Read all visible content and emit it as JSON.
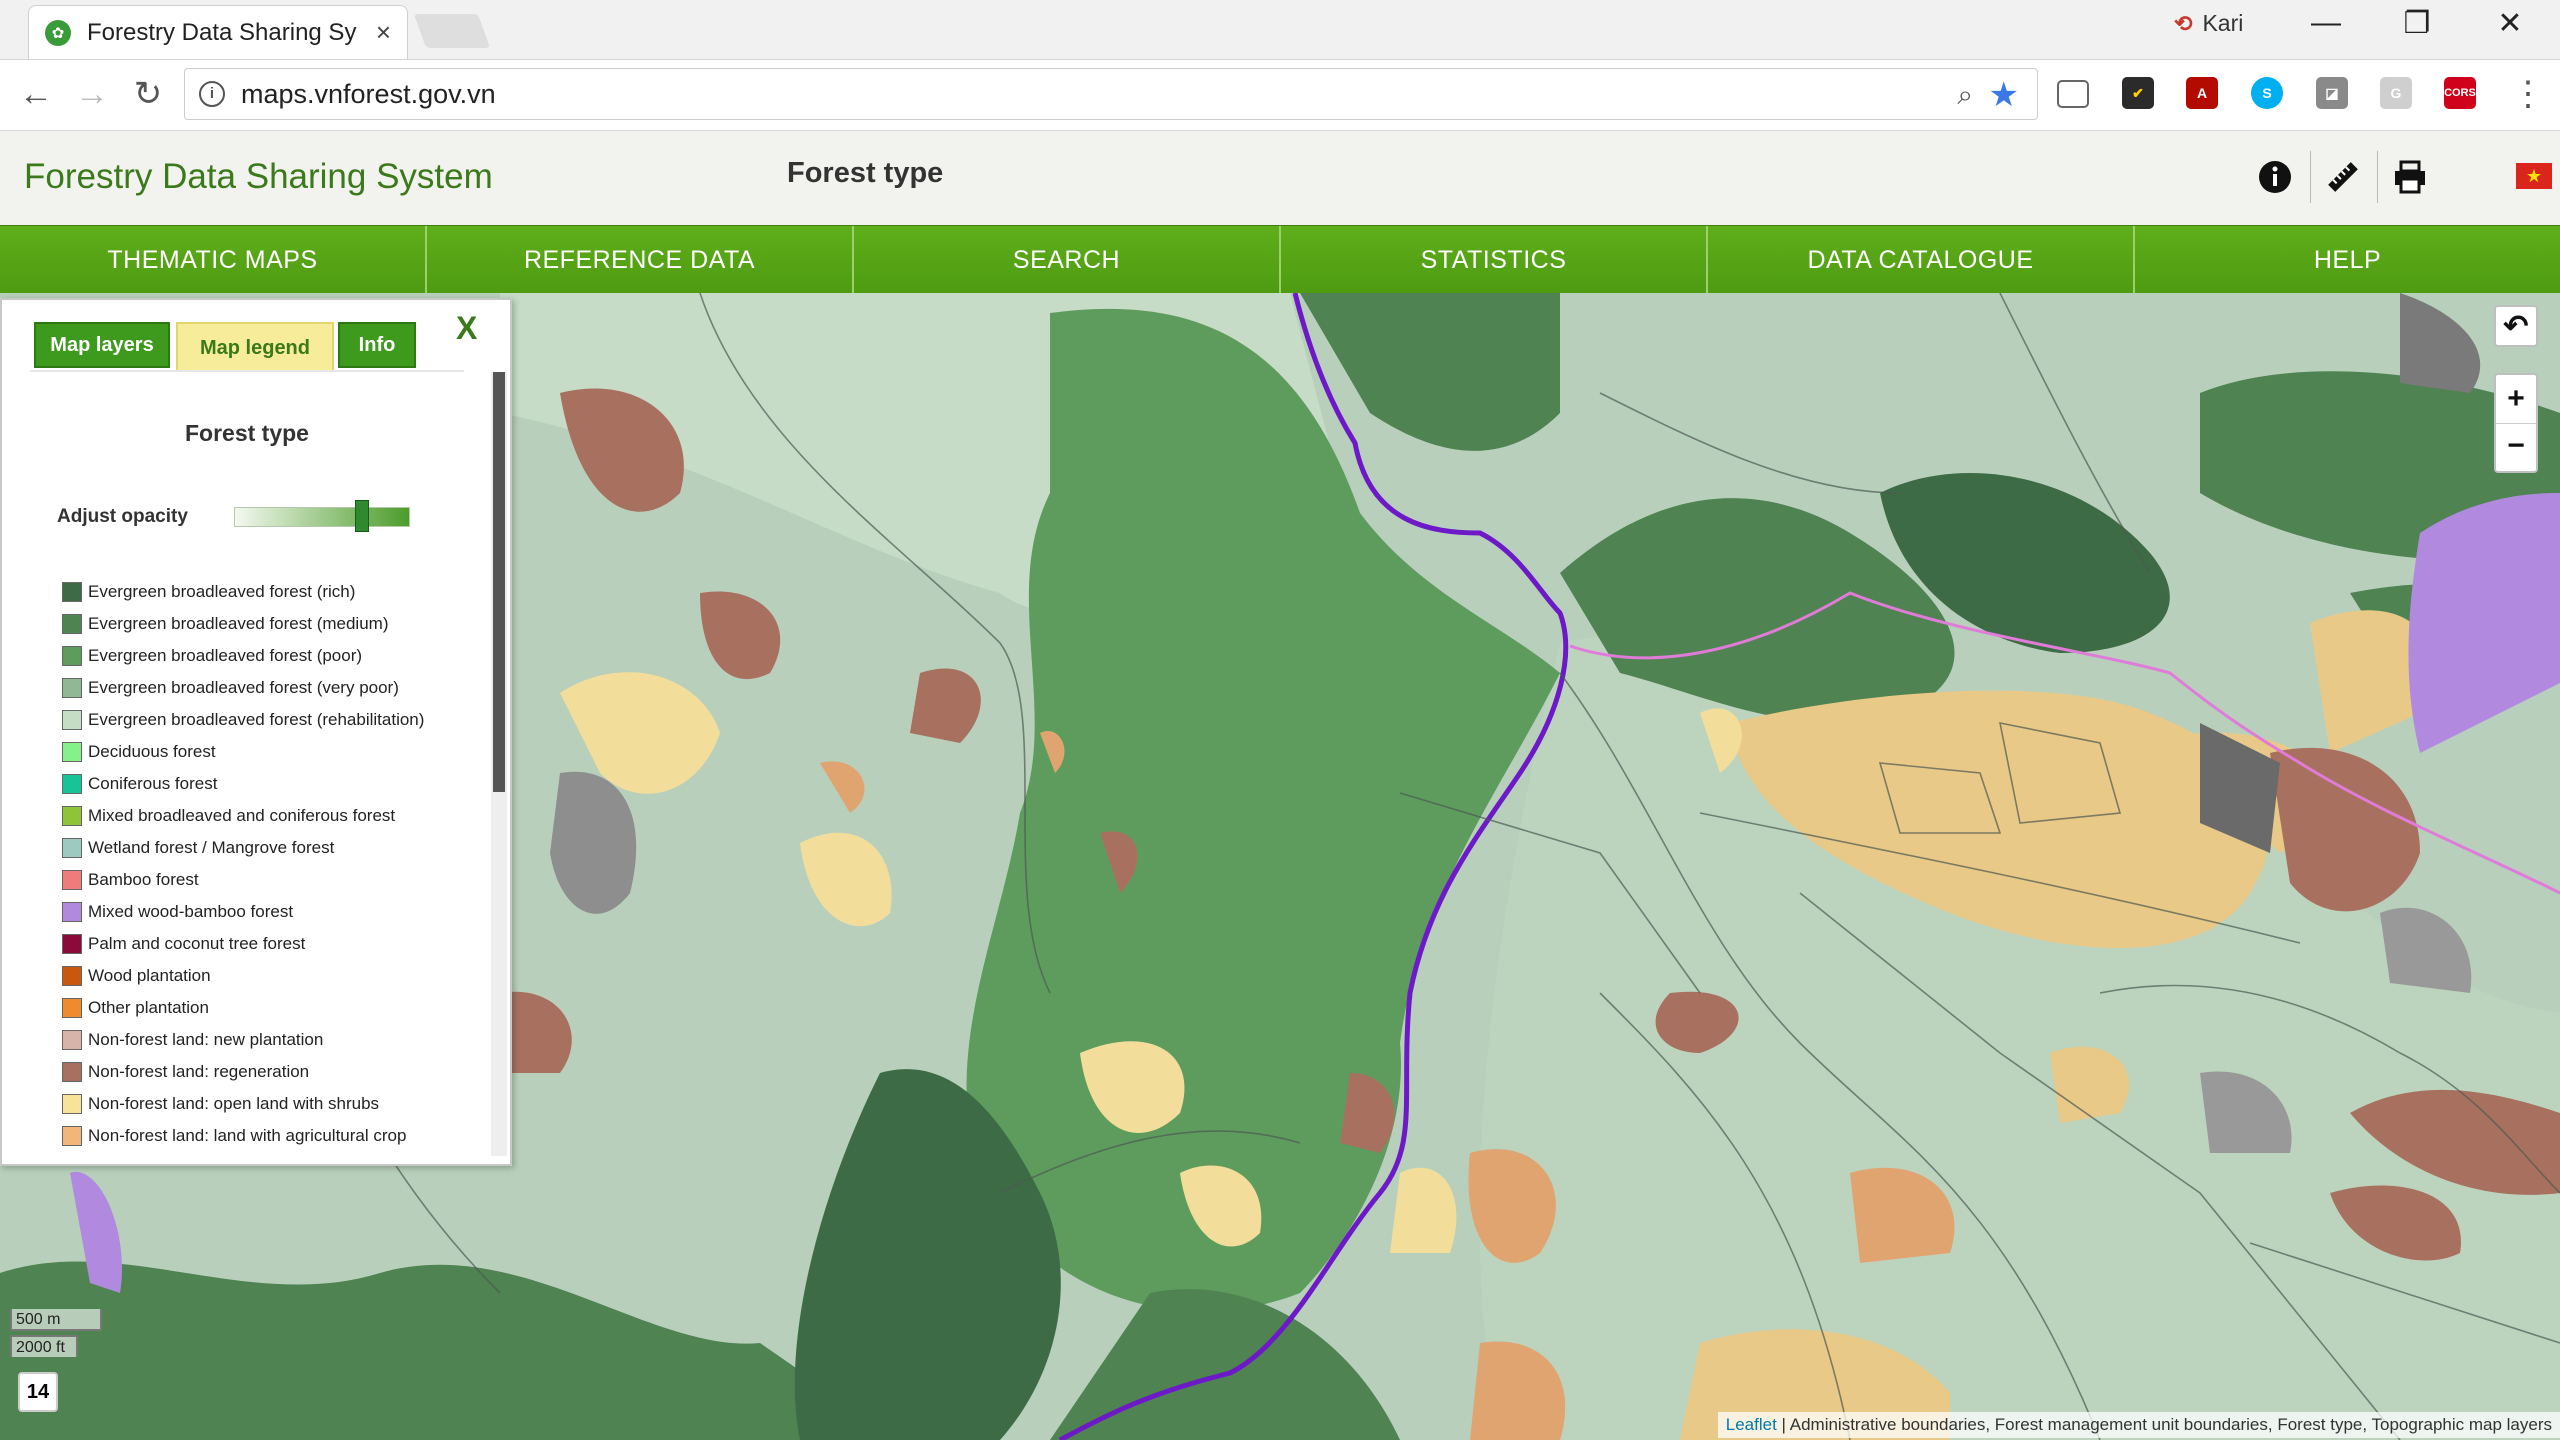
{
  "browser": {
    "tab_title": "Forestry Data Sharing Sy",
    "tab_close": "×",
    "user_name": "Kari",
    "url": "maps.vnforest.gov.vn",
    "extensions": [
      "cast-icon",
      "norton-icon",
      "acrobat-icon",
      "skype-icon",
      "extension-icon",
      "g-icon",
      "cors-icon"
    ],
    "cors_label": "CORS",
    "g_label": "G",
    "minimize": "—",
    "restore": "❐",
    "close": "✕"
  },
  "header": {
    "app_title": "Forestry Data Sharing System",
    "page_title": "Forest type"
  },
  "nav": {
    "items": [
      "THEMATIC MAPS",
      "REFERENCE DATA",
      "SEARCH",
      "STATISTICS",
      "DATA CATALOGUE",
      "HELP"
    ]
  },
  "panel": {
    "tabs": [
      "Map layers",
      "Map legend",
      "Info"
    ],
    "active_tab": "Map legend",
    "close": "X",
    "legend_title": "Forest type",
    "opacity_label": "Adjust opacity",
    "opacity_value": 0.73,
    "legend_items": [
      {
        "label": "Evergreen broadleaved forest (rich)",
        "color": "#3d6b45"
      },
      {
        "label": "Evergreen broadleaved forest (medium)",
        "color": "#4f8352"
      },
      {
        "label": "Evergreen broadleaved forest (poor)",
        "color": "#5e9c5e"
      },
      {
        "label": "Evergreen broadleaved forest (very poor)",
        "color": "#8fb893"
      },
      {
        "label": "Evergreen broadleaved forest (rehabilitation)",
        "color": "#c5dcc5"
      },
      {
        "label": "Deciduous forest",
        "color": "#86f08a"
      },
      {
        "label": "Coniferous forest",
        "color": "#17c497"
      },
      {
        "label": "Mixed broadleaved and coniferous forest",
        "color": "#8fc43a"
      },
      {
        "label": "Wetland forest / Mangrove forest",
        "color": "#9ec9c0"
      },
      {
        "label": "Bamboo forest",
        "color": "#f07b7b"
      },
      {
        "label": "Mixed wood-bamboo forest",
        "color": "#b18ae0"
      },
      {
        "label": "Palm and coconut tree forest",
        "color": "#8a0a3a"
      },
      {
        "label": "Wood plantation",
        "color": "#c9580e"
      },
      {
        "label": "Other plantation",
        "color": "#f08a2e"
      },
      {
        "label": "Non-forest land: new plantation",
        "color": "#d8b4a8"
      },
      {
        "label": "Non-forest land: regeneration",
        "color": "#a8715f"
      },
      {
        "label": "Non-forest land: open land with shrubs",
        "color": "#f7e39a"
      },
      {
        "label": "Non-forest land: land with agricultural crop",
        "color": "#f4b57a"
      },
      {
        "label": "",
        "color": "#e8e8e8"
      }
    ]
  },
  "map": {
    "zoom_in": "+",
    "zoom_out": "−",
    "back_icon": "↶",
    "scale_metric": "500 m",
    "scale_imperial": "2000 ft",
    "zoom_level": "14",
    "attribution_link": "Leaflet",
    "attribution_text": " | Administrative boundaries, Forest management unit boundaries, Forest type, Topographic map layers"
  }
}
